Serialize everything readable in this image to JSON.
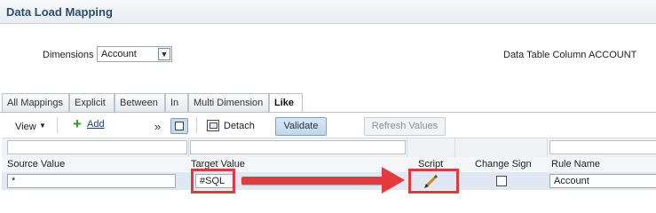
{
  "window": {
    "title": "Data Load Mapping"
  },
  "dimensions": {
    "label": "Dimensions",
    "selected": "Account"
  },
  "data_table_column": {
    "label": "Data Table Column",
    "value": "ACCOUNT"
  },
  "tabs": [
    {
      "label": "All Mappings"
    },
    {
      "label": "Explicit"
    },
    {
      "label": "Between"
    },
    {
      "label": "In"
    },
    {
      "label": "Multi Dimension"
    },
    {
      "label": "Like",
      "active": true
    }
  ],
  "toolbar": {
    "view_label": "View",
    "add_label": "Add",
    "more_glyph": "»",
    "detach_label": "Detach",
    "validate_label": "Validate",
    "refresh_label": "Refresh Values"
  },
  "table": {
    "columns": [
      "Source Value",
      "Target Value",
      "Script",
      "Change Sign",
      "Rule Name"
    ],
    "rows": [
      {
        "source_value": "*",
        "target_value": "#SQL",
        "change_sign": false,
        "rule_name": "Account"
      }
    ]
  },
  "colors": {
    "highlight": "#e0383b",
    "title": "#2d4d6b",
    "selected_row": "#dfe8f3"
  },
  "icons": [
    "chevron-down-icon",
    "add-icon",
    "query-by-example-icon",
    "detach-icon",
    "pencil-icon",
    "arrow-annotation"
  ]
}
